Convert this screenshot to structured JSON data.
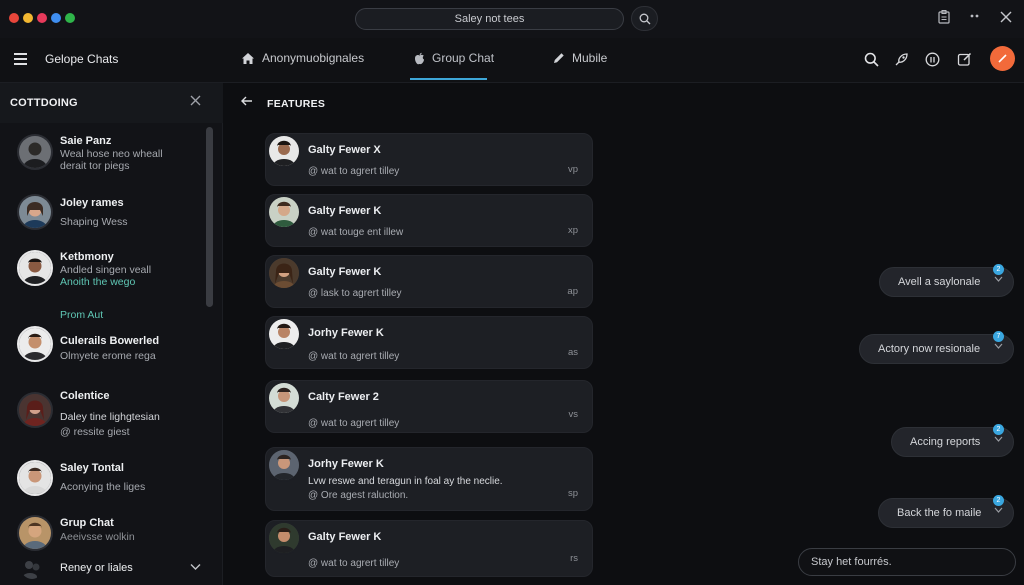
{
  "titlebar": {
    "traffic_dots": [
      "#e8463b",
      "#f2b731",
      "#e83a5b",
      "#3f8ef0",
      "#2fb54a"
    ],
    "search_text": "Saley not tees",
    "search_icon": "search-icon",
    "right_icons": [
      "clipboard-icon",
      "more-icon",
      "close-icon"
    ]
  },
  "nav": {
    "app_title": "Gelope Chats",
    "tabs": [
      {
        "label": "Anonymuobignales",
        "icon": "home-icon"
      },
      {
        "label": "Group Chat",
        "icon": "apple-icon"
      },
      {
        "label": "Mubile",
        "icon": "pencil-icon"
      }
    ],
    "active_tab": "Group Chat",
    "accent": "#3ea7d8",
    "right_icons": [
      "search-icon",
      "rocket-icon",
      "info-icon",
      "compose-icon",
      "profile-avatar"
    ]
  },
  "sidebar": {
    "title": "COTTDOING",
    "contacts": [
      {
        "name": "Saie Panz",
        "line1": "Weal hose neo wheall",
        "line2": "derait tor piegs"
      },
      {
        "name": "Joley rames",
        "line1": "Shaping Wess",
        "line2": ""
      },
      {
        "name": "Ketbmony",
        "line1": "Andled singen veall",
        "line2": "Anoith the wego"
      },
      {
        "name": "Culerails Bowerled",
        "line1": "Olmyete erome rega",
        "line2": ""
      },
      {
        "name": "Colentice",
        "line1": "Daley tine lighgtesian",
        "line2": "@ ressite giest"
      },
      {
        "name": "Saley Tontal",
        "line1": "Aconying the liges",
        "line2": ""
      },
      {
        "name": "Grup Chat",
        "line1": "Aeeivsse wolkin",
        "line2": ""
      },
      {
        "name": "Reney or liales",
        "line1": "",
        "line2": ""
      }
    ],
    "partial_item": "Prom Aut"
  },
  "main": {
    "title": "FEATURES",
    "messages": [
      {
        "title": "Galty Fewer X",
        "line1": "@ wat to agrert tilley",
        "line2": "",
        "time": "vp"
      },
      {
        "title": "Galty Fewer K",
        "line1": "@ wat touge ent illew",
        "line2": "",
        "time": "xp"
      },
      {
        "title": "Galty Fewer K",
        "line1": "@ lask to agrert tilley",
        "line2": "",
        "time": "ap"
      },
      {
        "title": "Jorhy Fewer K",
        "line1": "@ wat to agrert tilley",
        "line2": "",
        "time": "as"
      },
      {
        "title": "Calty Fewer 2",
        "line1": "@ wat to agrert tilley",
        "line2": "",
        "time": "vs"
      },
      {
        "title": "Jorhy Fewer K",
        "line1": "Lvw reswe and teragun in foal ay the neclie.",
        "line2": "@ Ore agest raluction.",
        "time": "sp"
      },
      {
        "title": "Galty Fewer K",
        "line1": "@ wat to agrert tilley",
        "line2": "",
        "time": "rs"
      }
    ]
  },
  "quick_replies": [
    {
      "label": "Avell a saylonale",
      "badge": "2"
    },
    {
      "label": "Actory now resionale",
      "badge": "7"
    },
    {
      "label": "Accing reports",
      "badge": "2"
    },
    {
      "label": "Back the fo maile",
      "badge": "2"
    }
  ],
  "composer": {
    "placeholder": "Stay het fourrés."
  },
  "colors": {
    "background": "#0d0e11",
    "card": "#1d1f24",
    "badge": "#3aa7e0",
    "orange_avatar": "#f26a3a"
  }
}
